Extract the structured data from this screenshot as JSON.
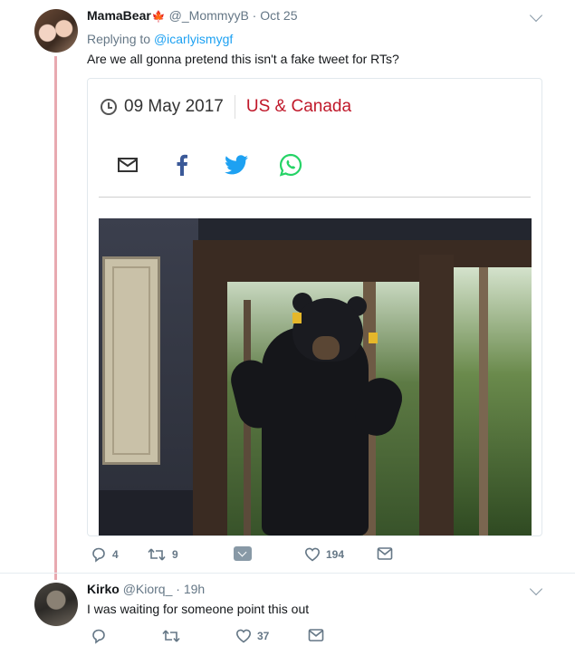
{
  "thread": [
    {
      "author_name": "MamaBear",
      "flag": "🍁",
      "handle": "@_MommyyB",
      "separator": "·",
      "date": "Oct 25",
      "replying_prefix": "Replying to",
      "replying_handle": "@icarlyismygf",
      "text": "Are we all gonna pretend this isn't a fake tweet for RTs?",
      "card": {
        "date": "09 May 2017",
        "region": "US & Canada",
        "share_icons": [
          "mail-icon",
          "facebook-icon",
          "twitter-icon",
          "whatsapp-icon"
        ],
        "photo": "black bear standing at glass door"
      },
      "actions": {
        "replies": "4",
        "retweets": "9",
        "likes": "194"
      }
    },
    {
      "author_name": "Kirko",
      "handle": "@Kiorq_",
      "separator": "·",
      "date": "19h",
      "text": "I was waiting for someone point this out",
      "actions": {
        "likes": "37"
      }
    }
  ],
  "colors": {
    "link_blue": "#1da1f2",
    "thread_line": "#e8a9b0",
    "region_red": "#c0182a",
    "muted": "#657786"
  }
}
